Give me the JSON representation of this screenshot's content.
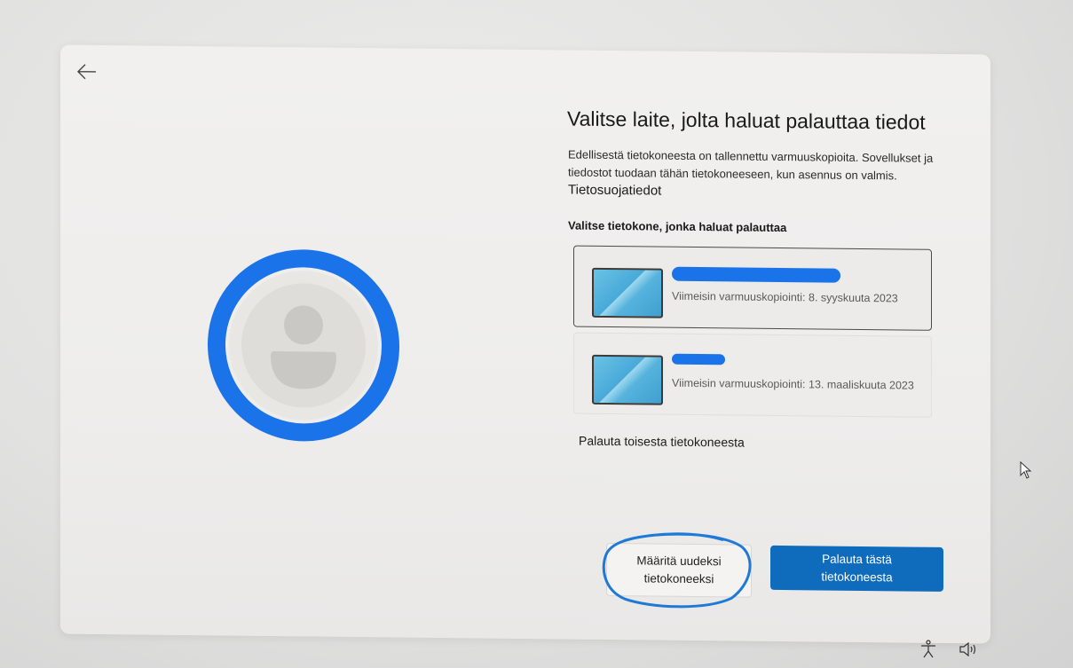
{
  "header": {
    "title": "Valitse laite, jolta haluat palauttaa tiedot",
    "description": "Edellisestä tietokoneesta on tallennettu varmuuskopioita. Sovellukset ja tiedostot tuodaan tähän tietokoneeseen, kun asennus on valmis.",
    "privacy_link": "Tietosuojatiedot"
  },
  "section_label": "Valitse tietokone, jonka haluat palauttaa",
  "devices": [
    {
      "date": "Viimeisin varmuuskopiointi: 8. syyskuuta 2023",
      "selected": true
    },
    {
      "date": "Viimeisin varmuuskopiointi: 13. maaliskuuta 2023",
      "selected": false
    }
  ],
  "restore_other": "Palauta toisesta tietokoneesta",
  "buttons": {
    "setup_new_line1": "Määritä uudeksi",
    "setup_new_line2": "tietokoneeksi",
    "restore_line1": "Palauta tästä",
    "restore_line2": "tietokoneesta"
  },
  "colors": {
    "accent": "#0f6cbd",
    "ring": "#1a73e8",
    "scribble": "#1e7ad6"
  },
  "icons": [
    "back-arrow-icon",
    "user-avatar-icon",
    "accessibility-icon",
    "volume-icon",
    "mouse-cursor-icon"
  ]
}
